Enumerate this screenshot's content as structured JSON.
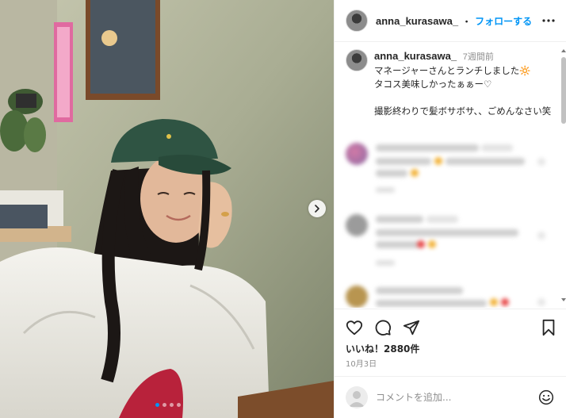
{
  "post": {
    "username": "anna_kurasawa_",
    "separator": "・",
    "follow_label": "フォローする",
    "caption_time": "7週間前",
    "caption_text": "マネージャーさんとランチしました🔆\nタコス美味しかったぁぁー♡\n\n撮影終わりで髪ボサボサ、、ごめんなさい笑",
    "likes": "いいね！2880件",
    "date": "10月3日"
  },
  "comment_box": {
    "placeholder": "コメントを追加..."
  },
  "icons": {
    "more": "more-options-icon",
    "next": "chevron-right-icon",
    "like": "heart-icon",
    "comment": "comment-icon",
    "share": "share-icon",
    "save": "bookmark-icon",
    "emoji": "emoji-icon"
  },
  "carousel": {
    "total": 4,
    "active": 1
  },
  "colors": {
    "accent": "#0095f6",
    "text": "#262626",
    "muted": "#8e8e8e",
    "border": "#efefef"
  }
}
